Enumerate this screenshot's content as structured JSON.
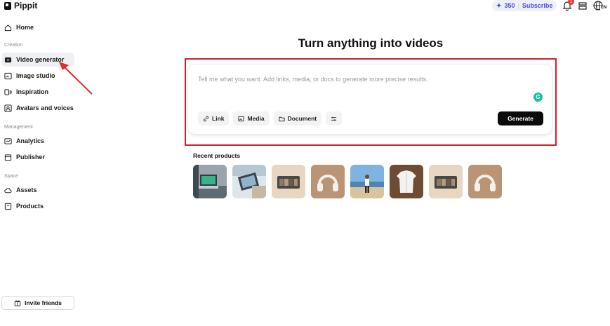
{
  "app": {
    "name": "Pippit"
  },
  "topbar": {
    "credits_value": "350",
    "subscribe_label": "Subscribe",
    "notification_count": "1",
    "language": "EN"
  },
  "sidebar": {
    "home": "Home",
    "section_creation": "Creation",
    "video_generator": "Video generator",
    "image_studio": "Image studio",
    "inspiration": "Inspiration",
    "avatars_voices": "Avatars and voices",
    "section_management": "Management",
    "analytics": "Analytics",
    "publisher": "Publisher",
    "section_space": "Space",
    "assets": "Assets",
    "products": "Products",
    "invite": "Invite friends"
  },
  "main": {
    "title": "Turn anything into videos",
    "prompt_placeholder": "Tell me what you want. Add links, media, or docs to generate more precise results.",
    "chips": {
      "link": "Link",
      "media": "Media",
      "document": "Document"
    },
    "generate_label": "Generate",
    "recent_title": "Recent products"
  },
  "colors": {
    "highlight": "#d32027",
    "arrow": "#e52b2b",
    "primary_button": "#0b0b0b",
    "accent": "#4a4ad6"
  }
}
